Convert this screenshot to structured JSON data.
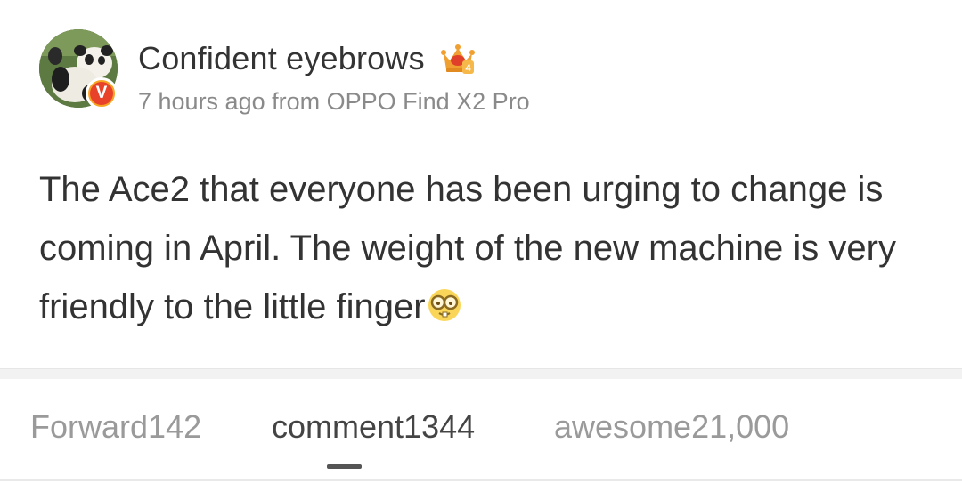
{
  "post": {
    "username": "Confident eyebrows",
    "meta": "7 hours ago from OPPO Find X2 Pro",
    "verified_badge_letter": "V",
    "crown_level": "4",
    "text": "The Ace2 that everyone has been urging to change is coming in April. The weight of the new machine is very friendly to the little finger",
    "icons": {
      "avatar": "panda-avatar",
      "verified": "verified-v-badge",
      "crown": "crown-icon",
      "emoji": "nerd-glasses-emoji"
    }
  },
  "tabs": {
    "forward": "Forward142",
    "comment": "comment1344",
    "awesome": "awesome21,000",
    "active": "comment"
  },
  "colors": {
    "text_primary": "#333333",
    "text_secondary": "#8a8a8a",
    "tab_inactive": "#9a9a9a",
    "verified_red": "#e8422a",
    "crown_orange": "#f0a030"
  }
}
